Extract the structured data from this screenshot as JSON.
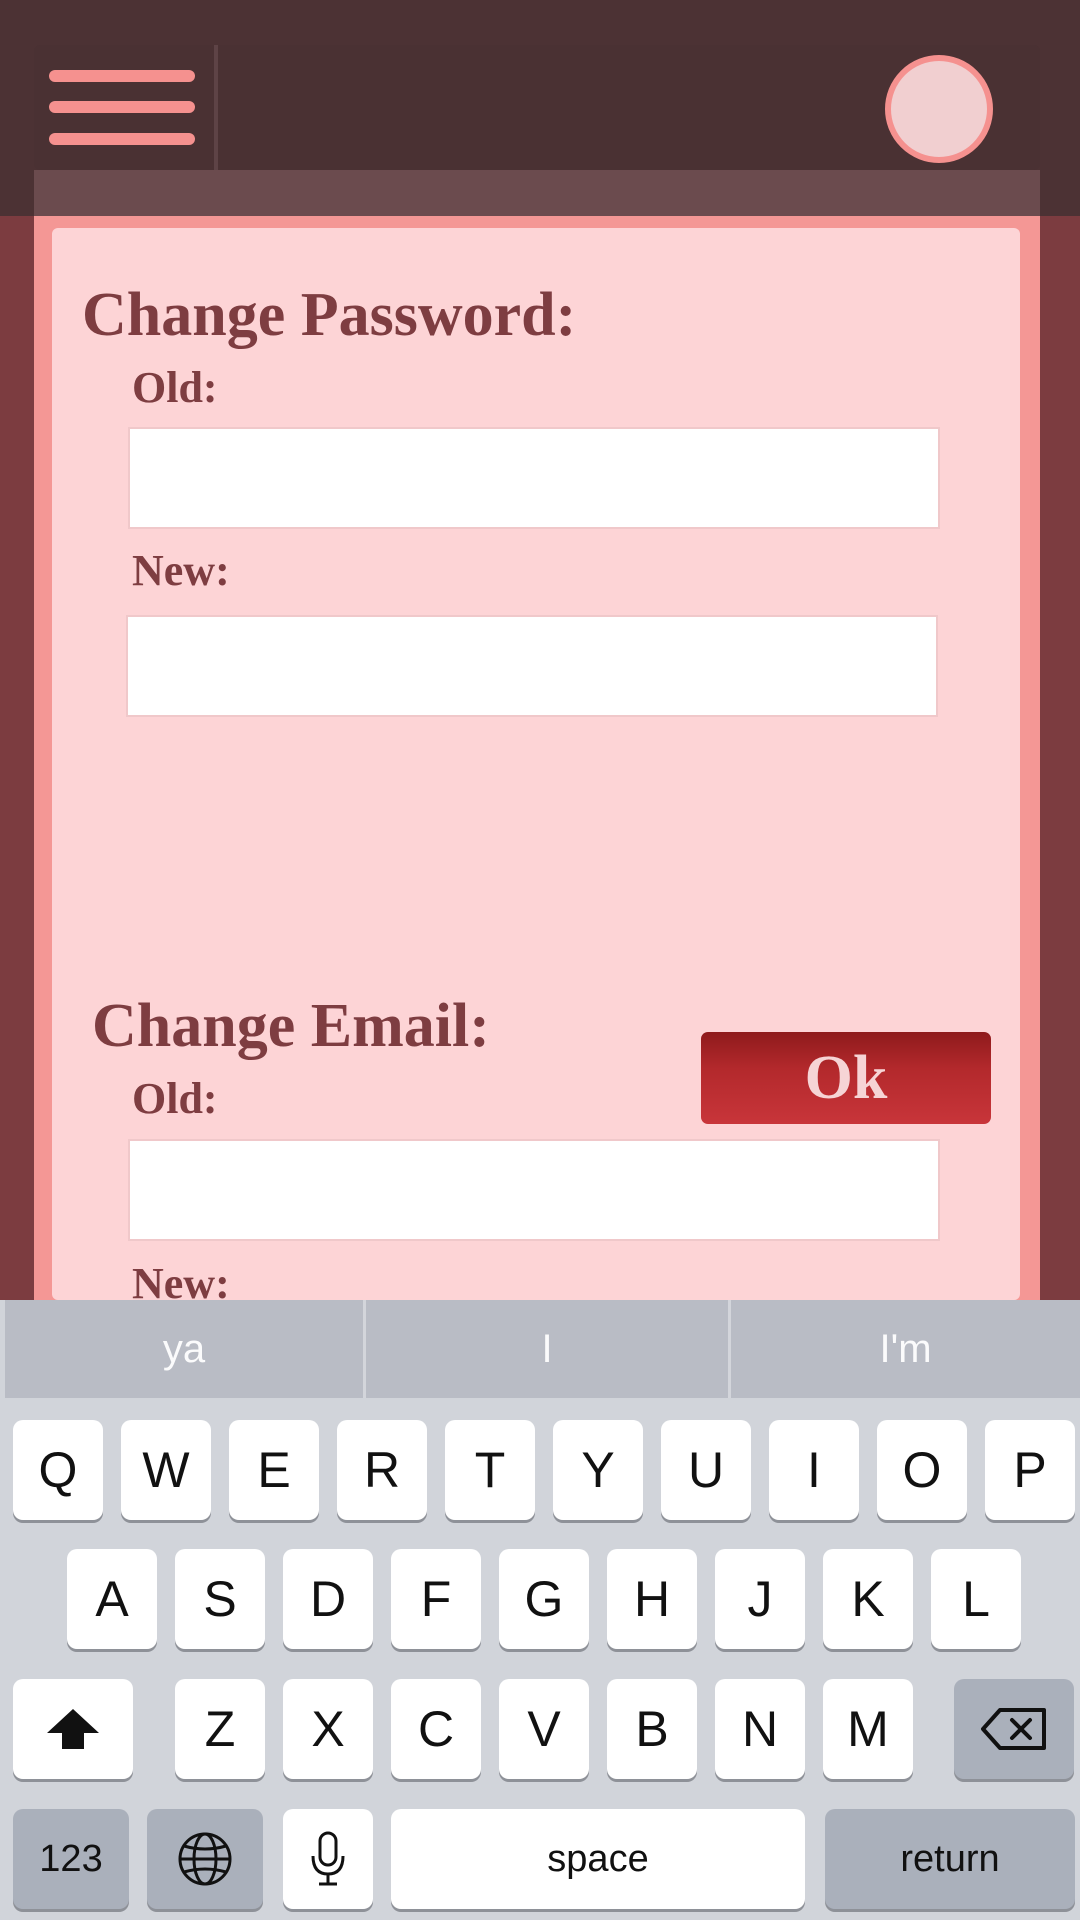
{
  "header": {
    "menu_icon": "hamburger-menu-icon",
    "avatar_icon": "profile-avatar-icon"
  },
  "password_section": {
    "title": "Change Password:",
    "old_label": "Old:",
    "new_label": "New:",
    "old_value": "",
    "new_value": "",
    "ok_label": "Ok"
  },
  "email_section": {
    "title": "Change Email:",
    "old_label": "Old:",
    "new_label": "New:",
    "old_value": ""
  },
  "keyboard": {
    "suggestions": [
      "ya",
      "I",
      "I'm"
    ],
    "row1": [
      "Q",
      "W",
      "E",
      "R",
      "T",
      "Y",
      "U",
      "I",
      "O",
      "P"
    ],
    "row2": [
      "A",
      "S",
      "D",
      "F",
      "G",
      "H",
      "J",
      "K",
      "L"
    ],
    "row3": [
      "Z",
      "X",
      "C",
      "V",
      "B",
      "N",
      "M"
    ],
    "numbers_label": "123",
    "space_label": "space",
    "return_label": "return",
    "shift_icon": "shift-icon",
    "backspace_icon": "backspace-icon",
    "globe_icon": "globe-icon",
    "mic_icon": "microphone-icon"
  },
  "colors": {
    "background": "#7c3c40",
    "header": "#4c3234",
    "panel": "#fdd4d6",
    "panel_border": "#f49795",
    "accent_text": "#7e3d41",
    "button": "#b3292c"
  }
}
